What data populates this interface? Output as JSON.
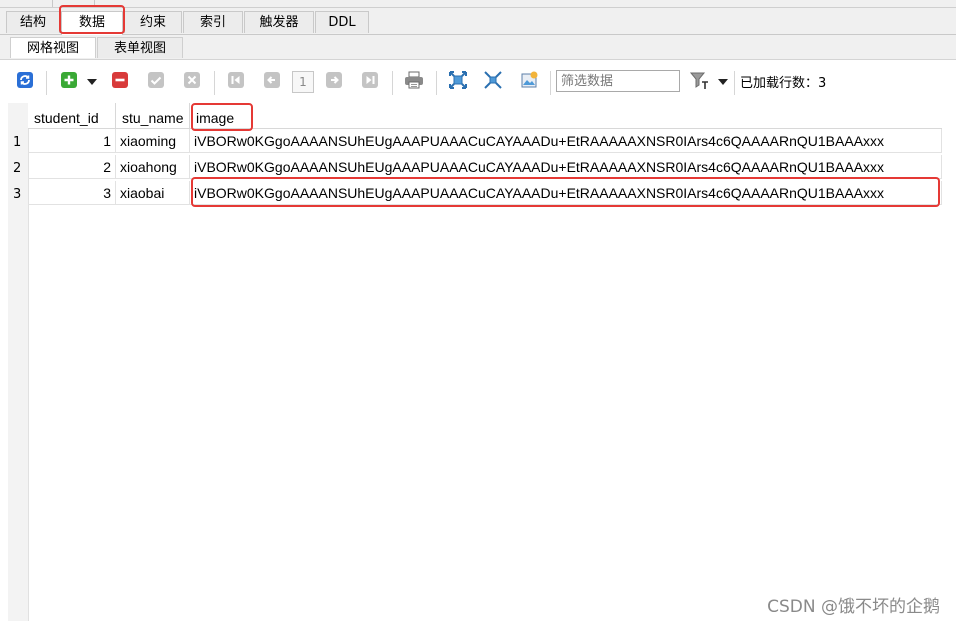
{
  "tabs": [
    {
      "label": "结构"
    },
    {
      "label": "数据"
    },
    {
      "label": "约束"
    },
    {
      "label": "索引"
    },
    {
      "label": "触发器"
    },
    {
      "label": "DDL"
    }
  ],
  "subtabs": [
    {
      "label": "网格视图"
    },
    {
      "label": "表单视图"
    }
  ],
  "toolbar": {
    "page_number": "1",
    "filter_placeholder": "筛选数据",
    "loaded_rows": "已加载行数：3",
    "icons": [
      "refresh-icon",
      "add-row-icon",
      "dropdown-arrow-icon",
      "delete-row-icon",
      "commit-check-icon",
      "cancel-x-icon",
      "first-page-icon",
      "prev-page-icon",
      "next-page-icon",
      "last-page-icon",
      "print-icon",
      "expand-icon",
      "collapse-icon",
      "export-image-icon",
      "filter-icon"
    ]
  },
  "table": {
    "columns": [
      "student_id",
      "stu_name",
      "image"
    ],
    "rows": [
      {
        "num": "1",
        "student_id": "1",
        "stu_name": "xiaoming",
        "image": "iVBORw0KGgoAAAANSUhEUgAAAPUAAACuCAYAAADu+EtRAAAAAXNSR0IArs4c6QAAAARnQU1BAAAxxx"
      },
      {
        "num": "2",
        "student_id": "2",
        "stu_name": "xioahong",
        "image": "iVBORw0KGgoAAAANSUhEUgAAAPUAAACuCAYAAADu+EtRAAAAAXNSR0IArs4c6QAAAARnQU1BAAAxxx"
      },
      {
        "num": "3",
        "student_id": "3",
        "stu_name": "xiaobai",
        "image": "iVBORw0KGgoAAAANSUhEUgAAAPUAAACuCAYAAADu+EtRAAAAAXNSR0IArs4c6QAAAARnQU1BAAAxxx"
      }
    ]
  },
  "watermark": "CSDN @饿不坏的企鹅",
  "colors": {
    "highlight": "#e53935",
    "add": "#3aa935",
    "delete": "#d83a3a",
    "refresh": "#2a6fd6"
  }
}
